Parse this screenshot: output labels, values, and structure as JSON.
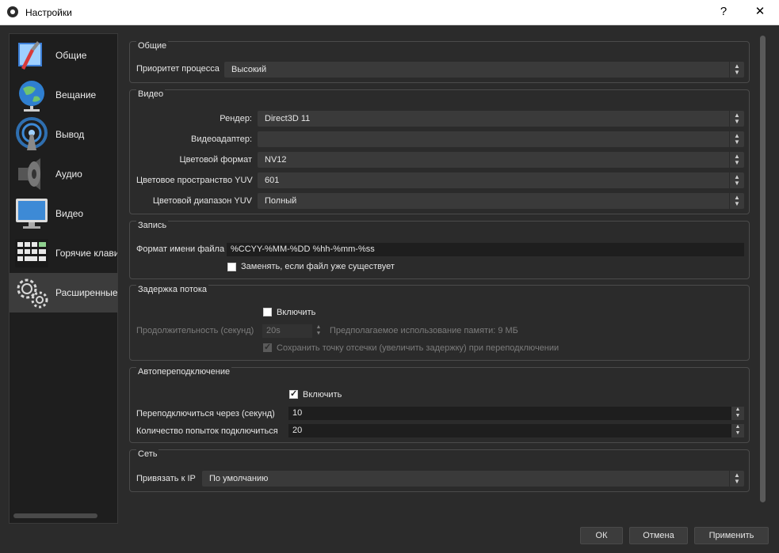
{
  "window": {
    "title": "Настройки",
    "help_label": "?",
    "close_label": "✕"
  },
  "sidebar": {
    "items": [
      {
        "label": "Общие",
        "icon": "general-icon"
      },
      {
        "label": "Вещание",
        "icon": "stream-globe-icon"
      },
      {
        "label": "Вывод",
        "icon": "output-broadcast-icon"
      },
      {
        "label": "Аудио",
        "icon": "speaker-icon"
      },
      {
        "label": "Видео",
        "icon": "monitor-icon"
      },
      {
        "label": "Горячие клавиши",
        "icon": "keyboard-icon"
      },
      {
        "label": "Расширенные",
        "icon": "gears-icon"
      }
    ],
    "active_index": 6
  },
  "general": {
    "title": "Общие",
    "priority_label": "Приоритет процесса",
    "priority_value": "Высокий"
  },
  "video": {
    "title": "Видео",
    "renderer_label": "Рендер:",
    "renderer_value": "Direct3D 11",
    "adapter_label": "Видеоадаптер:",
    "adapter_value": "",
    "format_label": "Цветовой формат",
    "format_value": "NV12",
    "colorspace_label": "Цветовое пространство YUV",
    "colorspace_value": "601",
    "range_label": "Цветовой диапазон YUV",
    "range_value": "Полный"
  },
  "recording": {
    "title": "Запись",
    "filename_label": "Формат имени файла",
    "filename_value": "%CCYY-%MM-%DD %hh-%mm-%ss",
    "overwrite_label": "Заменять, если файл уже существует",
    "overwrite_checked": false
  },
  "stream_delay": {
    "title": "Задержка потока",
    "enable_label": "Включить",
    "enable_checked": false,
    "duration_label": "Продолжительность (секунд)",
    "duration_value": "20s",
    "memory_label": "Предполагаемое использование памяти: 9 МБ",
    "preserve_label": "Сохранить точку отсечки (увеличить задержку) при переподключении",
    "preserve_checked": true
  },
  "reconnect": {
    "title": "Автопереподключение",
    "enable_label": "Включить",
    "enable_checked": true,
    "retry_delay_label": "Переподключиться через (секунд)",
    "retry_delay_value": "10",
    "max_retries_label": "Количество попыток подключиться",
    "max_retries_value": "20"
  },
  "network": {
    "title": "Сеть",
    "bind_ip_label": "Привязать к IP",
    "bind_ip_value": "По умолчанию"
  },
  "buttons": {
    "ok": "ОК",
    "cancel": "Отмена",
    "apply": "Применить"
  },
  "colors": {
    "background": "#2b2b2b",
    "sidebar": "#1e1e1e",
    "active_item": "#3c3c3c",
    "text": "#e6e6e6"
  }
}
